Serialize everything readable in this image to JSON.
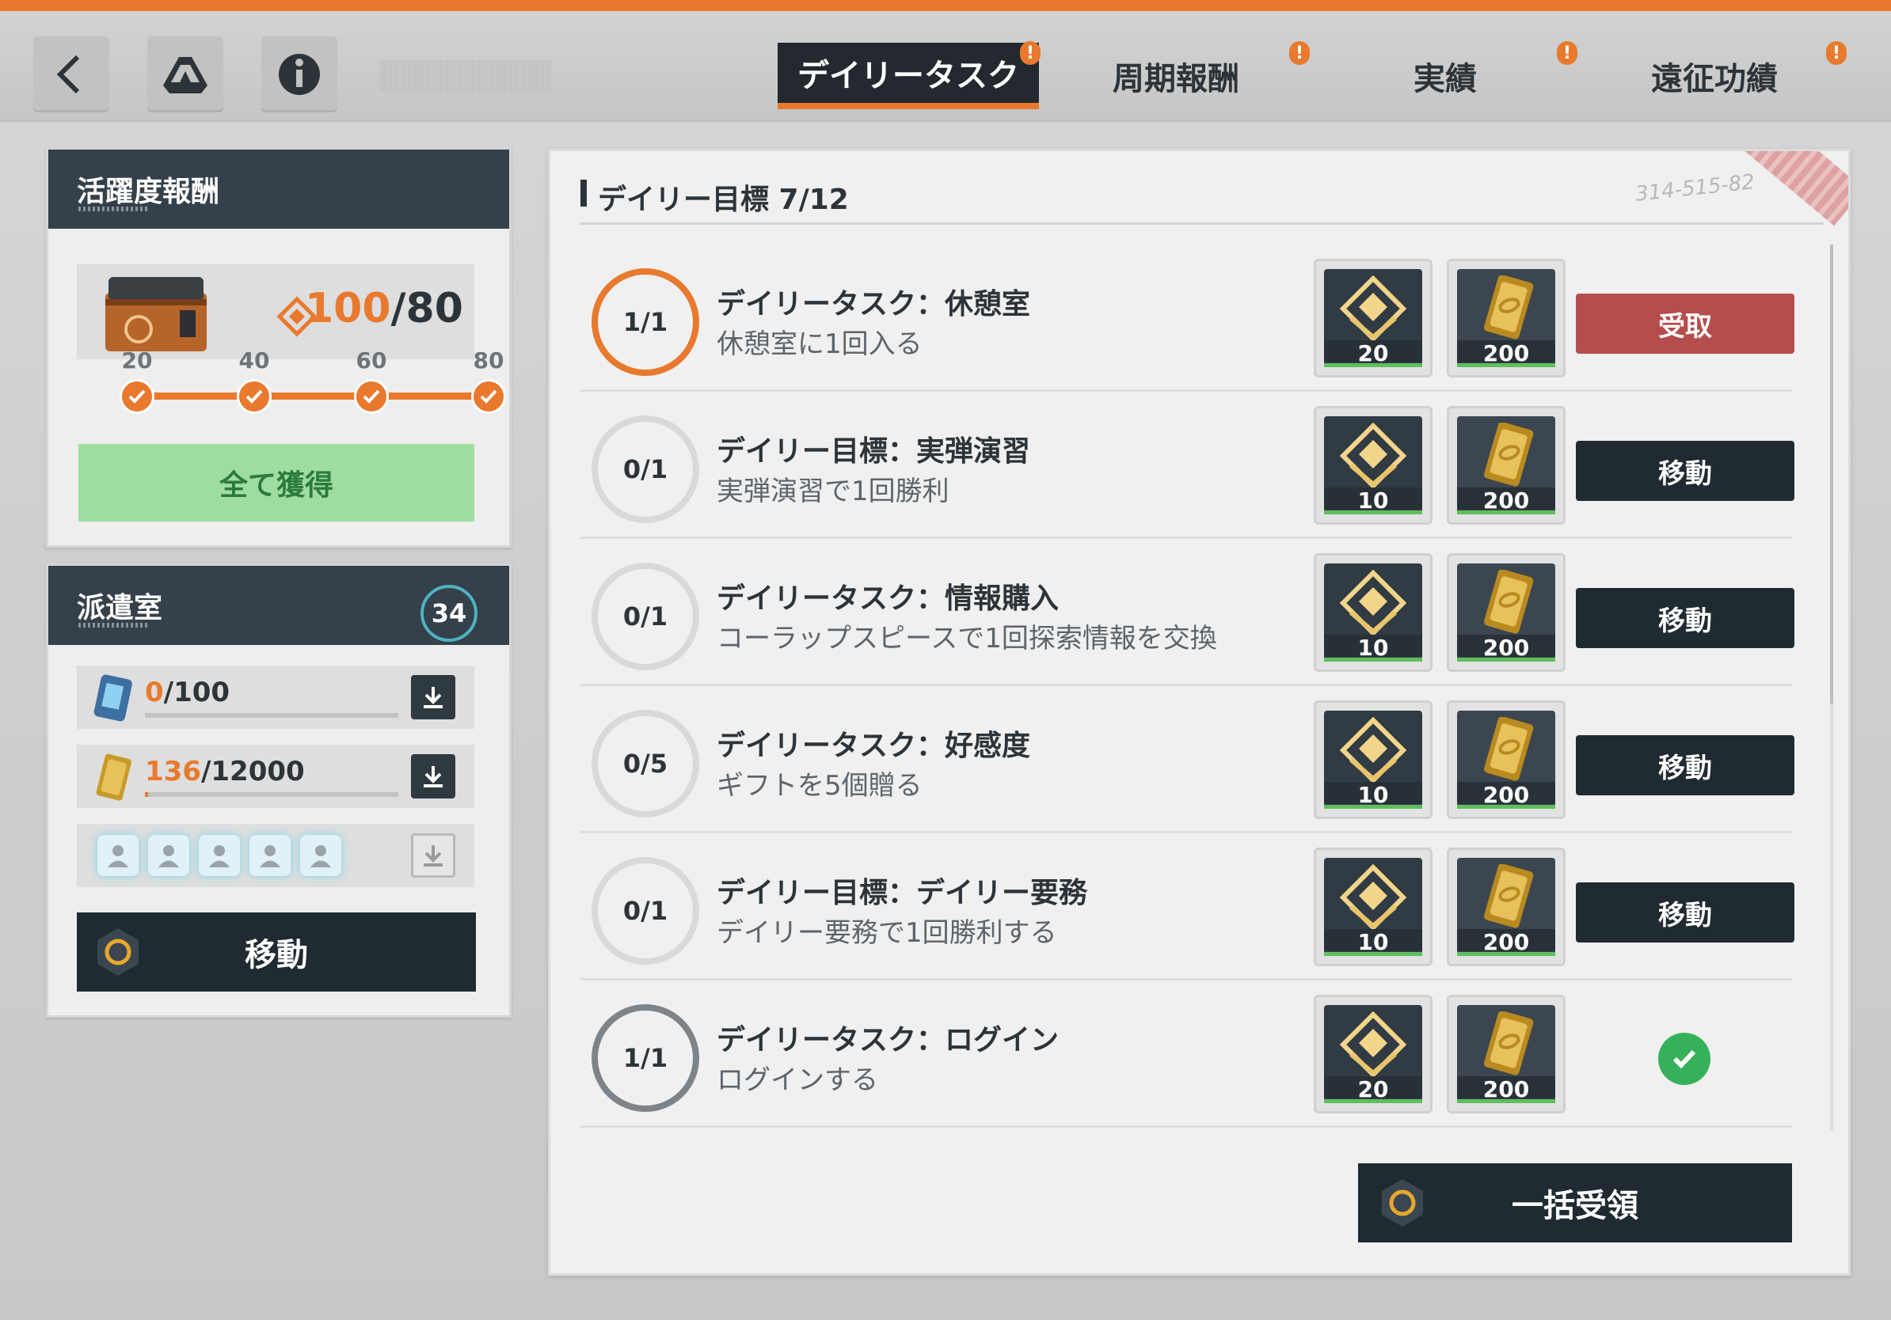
{
  "header": {
    "tabs": [
      {
        "label": "デイリータスク",
        "active": true,
        "badge": "!"
      },
      {
        "label": "周期報酬",
        "active": false,
        "badge": "!"
      },
      {
        "label": "実績",
        "active": false,
        "badge": "!"
      },
      {
        "label": "遠征功績",
        "active": false,
        "badge": "!"
      }
    ],
    "icons": [
      "back-arrow-icon",
      "drive-icon",
      "info-icon"
    ]
  },
  "activity": {
    "title": "活躍度報酬",
    "current": "100",
    "max": "/80",
    "milestones": [
      "20",
      "40",
      "60",
      "80"
    ],
    "claim_all_label": "全て獲得"
  },
  "dispatch": {
    "title": "派遣室",
    "badge": "34",
    "resources": [
      {
        "current": "0",
        "max": "/100",
        "progress": 0.0,
        "icon": "chip-icon"
      },
      {
        "current": "136",
        "max": "/12000",
        "progress": 0.011,
        "icon": "gold-bar-icon"
      }
    ],
    "slots": 5,
    "move_label": "移動"
  },
  "tasks": {
    "header": "デイリー目標 7/12",
    "serial": "314-515-82",
    "items": [
      {
        "progress": "1/1",
        "title": "デイリータスク：休憩室",
        "desc": "休憩室に1回入る",
        "reward1": "20",
        "reward2": "200",
        "action": "受取",
        "state": "claim"
      },
      {
        "progress": "0/1",
        "title": "デイリー目標：実弾演習",
        "desc": "実弾演習で1回勝利",
        "reward1": "10",
        "reward2": "200",
        "action": "移動",
        "state": "go"
      },
      {
        "progress": "0/1",
        "title": "デイリータスク：情報購入",
        "desc": "コーラップスピースで1回探索情報を交換",
        "reward1": "10",
        "reward2": "200",
        "action": "移動",
        "state": "go"
      },
      {
        "progress": "0/5",
        "title": "デイリータスク：好感度",
        "desc": "ギフトを5個贈る",
        "reward1": "10",
        "reward2": "200",
        "action": "移動",
        "state": "go"
      },
      {
        "progress": "0/1",
        "title": "デイリー目標：デイリー要務",
        "desc": "デイリー要務で1回勝利する",
        "reward1": "10",
        "reward2": "200",
        "action": "移動",
        "state": "go"
      },
      {
        "progress": "1/1",
        "title": "デイリータスク：ログイン",
        "desc": "ログインする",
        "reward1": "20",
        "reward2": "200",
        "action": "",
        "state": "done"
      }
    ],
    "bulk_label": "一括受領"
  },
  "colors": {
    "accent": "#e8792d",
    "dark": "#1f2a31",
    "claim": "#b54d4d",
    "done": "#35b15a"
  }
}
